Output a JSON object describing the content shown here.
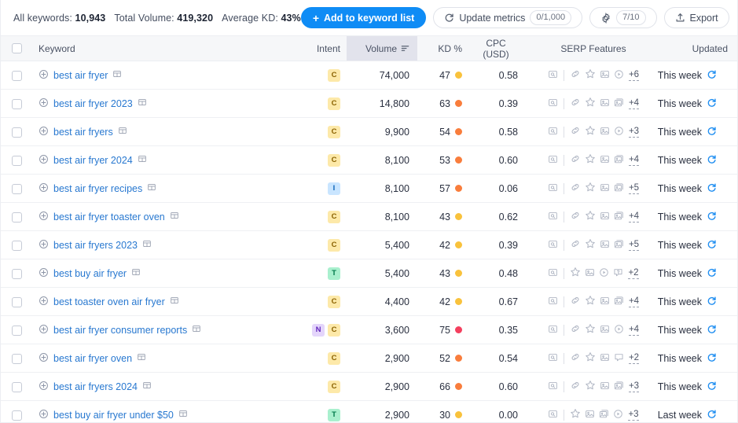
{
  "toolbar": {
    "stats": {
      "all_keywords_label": "All keywords:",
      "all_keywords_value": "10,943",
      "total_volume_label": "Total Volume:",
      "total_volume_value": "419,320",
      "average_kd_label": "Average KD:",
      "average_kd_value": "43%"
    },
    "add_to_list_label": "Add to keyword list",
    "add_to_list_plus": "+",
    "update_metrics_label": "Update metrics",
    "update_metrics_count": "0/1,000",
    "settings_count": "7/10",
    "export_label": "Export",
    "primary_color": "#0f8cf5"
  },
  "table": {
    "columns": {
      "keyword": "Keyword",
      "intent": "Intent",
      "volume": "Volume",
      "kd": "KD %",
      "cpc": "CPC (USD)",
      "serp": "SERP Features",
      "updated": "Updated"
    },
    "sorted_column": "volume",
    "sort_direction": "desc",
    "kd_colors": {
      "low": "#f9c23c",
      "medium": "#f97d3c",
      "high": "#f43f5e"
    },
    "rows": [
      {
        "keyword": "best air fryer",
        "intents": [
          "C"
        ],
        "volume": "74,000",
        "kd": "47",
        "kd_level": "low",
        "cpc": "0.58",
        "serp_icons": [
          "search-box-icon",
          "sitelinks-icon",
          "reviews-icon",
          "image-icon",
          "video-icon"
        ],
        "serp_more": "+6",
        "updated": "This week"
      },
      {
        "keyword": "best air fryer 2023",
        "intents": [
          "C"
        ],
        "volume": "14,800",
        "kd": "63",
        "kd_level": "medium",
        "cpc": "0.39",
        "serp_icons": [
          "search-box-icon",
          "sitelinks-icon",
          "reviews-icon",
          "image-icon",
          "image-pack-icon"
        ],
        "serp_more": "+4",
        "updated": "This week"
      },
      {
        "keyword": "best air fryers",
        "intents": [
          "C"
        ],
        "volume": "9,900",
        "kd": "54",
        "kd_level": "medium",
        "cpc": "0.58",
        "serp_icons": [
          "search-box-icon",
          "sitelinks-icon",
          "reviews-icon",
          "image-icon",
          "video-icon"
        ],
        "serp_more": "+3",
        "updated": "This week"
      },
      {
        "keyword": "best air fryer 2024",
        "intents": [
          "C"
        ],
        "volume": "8,100",
        "kd": "53",
        "kd_level": "medium",
        "cpc": "0.60",
        "serp_icons": [
          "search-box-icon",
          "sitelinks-icon",
          "reviews-icon",
          "image-icon",
          "image-pack-icon"
        ],
        "serp_more": "+4",
        "updated": "This week"
      },
      {
        "keyword": "best air fryer recipes",
        "intents": [
          "I"
        ],
        "volume": "8,100",
        "kd": "57",
        "kd_level": "medium",
        "cpc": "0.06",
        "serp_icons": [
          "search-box-icon",
          "sitelinks-icon",
          "reviews-icon",
          "image-icon",
          "image-pack-icon"
        ],
        "serp_more": "+5",
        "updated": "This week"
      },
      {
        "keyword": "best air fryer toaster oven",
        "intents": [
          "C"
        ],
        "volume": "8,100",
        "kd": "43",
        "kd_level": "low",
        "cpc": "0.62",
        "serp_icons": [
          "search-box-icon",
          "sitelinks-icon",
          "reviews-icon",
          "image-icon",
          "image-pack-icon"
        ],
        "serp_more": "+4",
        "updated": "This week"
      },
      {
        "keyword": "best air fryers 2023",
        "intents": [
          "C"
        ],
        "volume": "5,400",
        "kd": "42",
        "kd_level": "low",
        "cpc": "0.39",
        "serp_icons": [
          "search-box-icon",
          "sitelinks-icon",
          "reviews-icon",
          "image-icon",
          "image-pack-icon"
        ],
        "serp_more": "+5",
        "updated": "This week"
      },
      {
        "keyword": "best buy air fryer",
        "intents": [
          "T"
        ],
        "volume": "5,400",
        "kd": "43",
        "kd_level": "low",
        "cpc": "0.48",
        "serp_icons": [
          "search-box-icon",
          "reviews-icon",
          "image-icon",
          "video-icon",
          "faq-icon"
        ],
        "serp_more": "+2",
        "updated": "This week"
      },
      {
        "keyword": "best toaster oven air fryer",
        "intents": [
          "C"
        ],
        "volume": "4,400",
        "kd": "42",
        "kd_level": "low",
        "cpc": "0.67",
        "serp_icons": [
          "search-box-icon",
          "sitelinks-icon",
          "reviews-icon",
          "image-icon",
          "image-pack-icon"
        ],
        "serp_more": "+4",
        "updated": "This week"
      },
      {
        "keyword": "best air fryer consumer reports",
        "intents": [
          "N",
          "C"
        ],
        "volume": "3,600",
        "kd": "75",
        "kd_level": "high",
        "cpc": "0.35",
        "serp_icons": [
          "search-box-icon",
          "sitelinks-icon",
          "reviews-icon",
          "image-icon",
          "video-icon"
        ],
        "serp_more": "+4",
        "updated": "This week"
      },
      {
        "keyword": "best air fryer oven",
        "intents": [
          "C"
        ],
        "volume": "2,900",
        "kd": "52",
        "kd_level": "medium",
        "cpc": "0.54",
        "serp_icons": [
          "search-box-icon",
          "sitelinks-icon",
          "reviews-icon",
          "image-icon",
          "discussion-icon"
        ],
        "serp_more": "+2",
        "updated": "This week"
      },
      {
        "keyword": "best air fryers 2024",
        "intents": [
          "C"
        ],
        "volume": "2,900",
        "kd": "66",
        "kd_level": "medium",
        "cpc": "0.60",
        "serp_icons": [
          "search-box-icon",
          "sitelinks-icon",
          "reviews-icon",
          "image-icon",
          "image-pack-icon"
        ],
        "serp_more": "+3",
        "updated": "This week"
      },
      {
        "keyword": "best buy air fryer under $50",
        "intents": [
          "T"
        ],
        "volume": "2,900",
        "kd": "30",
        "kd_level": "low",
        "cpc": "0.00",
        "serp_icons": [
          "search-box-icon",
          "reviews-icon",
          "image-icon",
          "image-pack-icon",
          "video-icon"
        ],
        "serp_more": "+3",
        "updated": "Last week"
      }
    ]
  }
}
